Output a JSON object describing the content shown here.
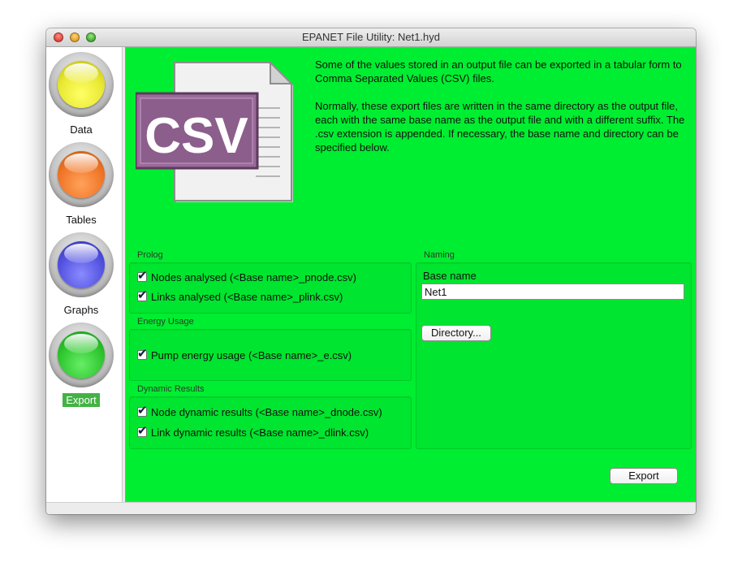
{
  "window": {
    "title": "EPANET File Utility: Net1.hyd"
  },
  "sidebar": {
    "items": [
      {
        "label": "Data",
        "color": "#e8e832",
        "active": false
      },
      {
        "label": "Tables",
        "color": "#f07628",
        "active": false
      },
      {
        "label": "Graphs",
        "color": "#5353e0",
        "active": false
      },
      {
        "label": "Export",
        "color": "#2fc62f",
        "active": true
      }
    ]
  },
  "icon": {
    "name": "csv-file-icon",
    "text": "CSV"
  },
  "intro": {
    "paragraph1": "Some of the values stored in an output file can be exported in a tabular form to Comma Separated Values (CSV) files.",
    "paragraph2": "Normally, these export files are written in the same directory as the output file, each with the same base name as the output file and with a different suffix.  The .csv extension is appended.  If necessary, the base name and directory can be specified below."
  },
  "prolog": {
    "title": "Prolog",
    "nodes": {
      "label": "Nodes analysed  (<Base name>_pnode.csv)",
      "checked": true
    },
    "links": {
      "label": "Links analysed  (<Base name>_plink.csv)",
      "checked": true
    }
  },
  "energy": {
    "title": "Energy Usage",
    "pump": {
      "label": "Pump energy usage  (<Base name>_e.csv)",
      "checked": true
    }
  },
  "dynamic": {
    "title": "Dynamic Results",
    "node": {
      "label": "Node dynamic results  (<Base name>_dnode.csv)",
      "checked": true
    },
    "link": {
      "label": "Link dynamic results  (<Base name>_dlink.csv)",
      "checked": true
    }
  },
  "naming": {
    "title": "Naming",
    "base_label": "Base name",
    "base_value": "Net1",
    "directory_label": "Directory..."
  },
  "export_label": "Export",
  "colors": {
    "panel_green": "#00ee31",
    "csv_purple": "#8c5e8c"
  }
}
